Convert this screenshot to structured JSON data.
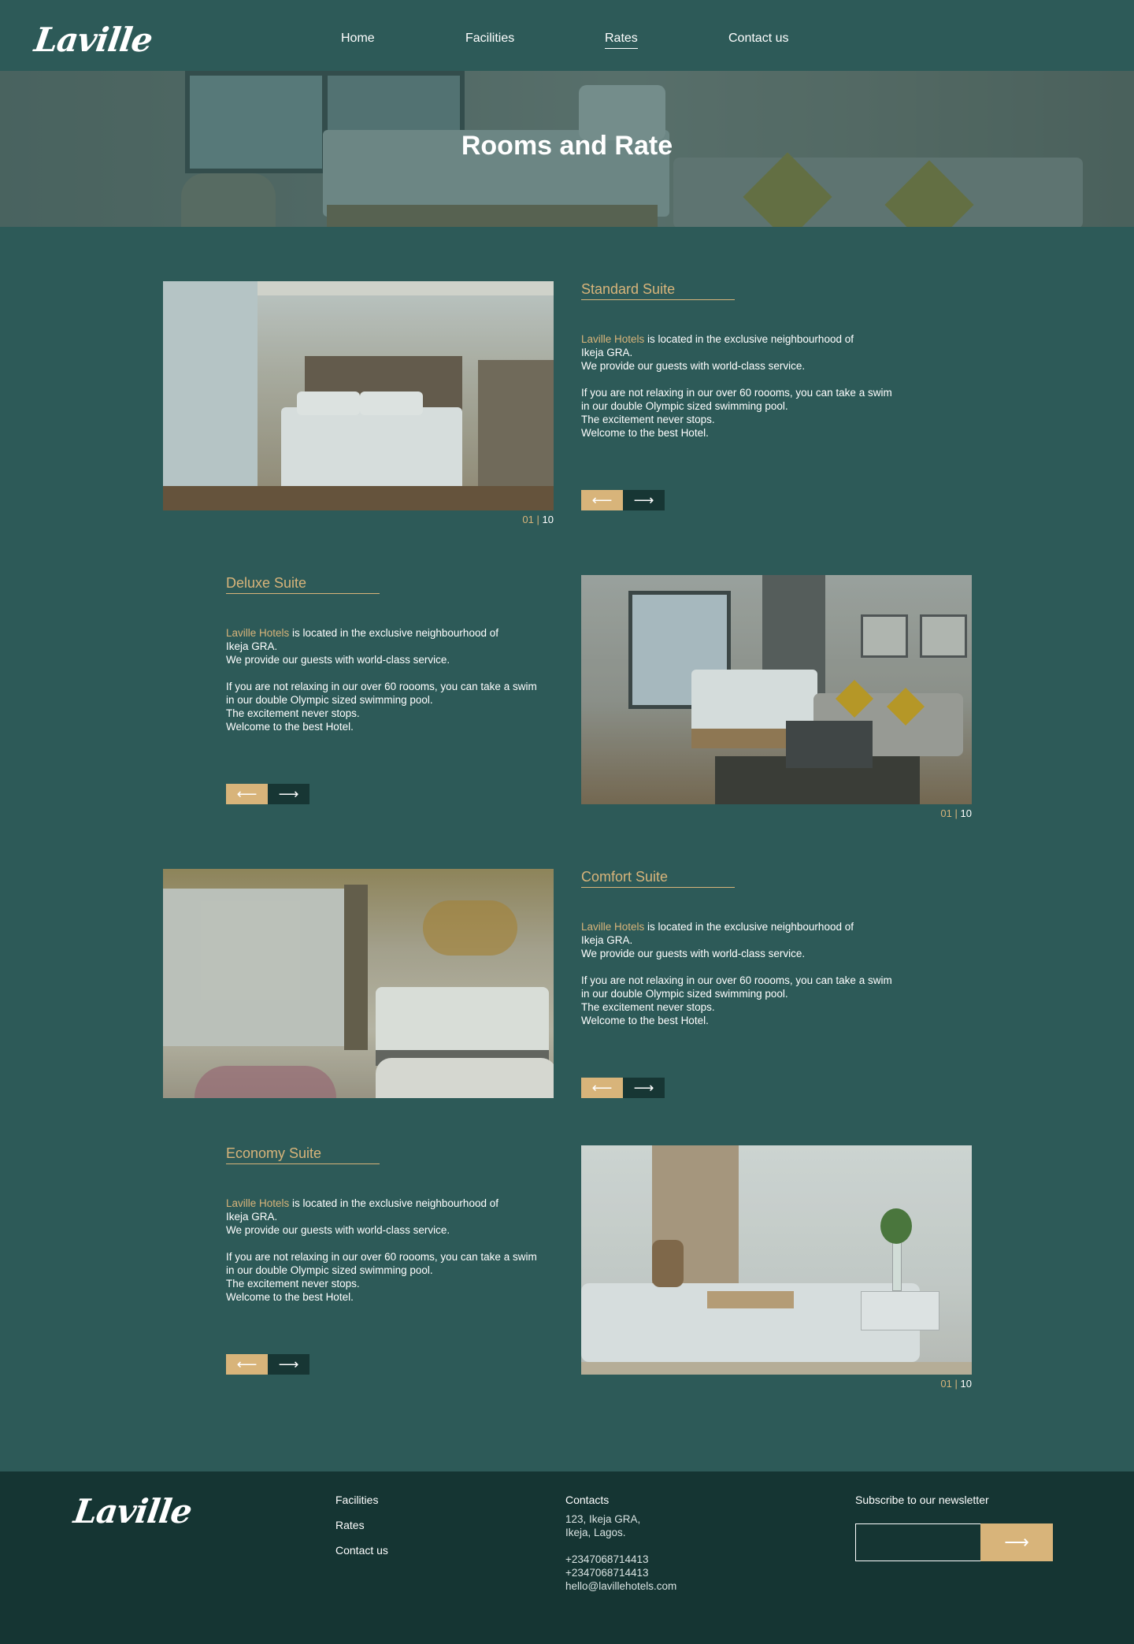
{
  "header": {
    "logo": "Laville",
    "nav": [
      {
        "label": "Home",
        "active": false
      },
      {
        "label": "Facilities",
        "active": false
      },
      {
        "label": "Rates",
        "active": true
      },
      {
        "label": "Contact us",
        "active": false
      }
    ]
  },
  "hero": {
    "title": "Rooms and Rate"
  },
  "rooms": [
    {
      "title": "Standard Suite",
      "brand": "Laville Hotels",
      "line1": " is located in the exclusive neighbourhood of",
      "line2": "Ikeja GRA.",
      "line3": "We provide our guests with world-class service.",
      "para2_1": "If you are not relaxing in our over 60 roooms, you can take a swim",
      "para2_2": "in our double Olympic sized swimming pool.",
      "para2_3": "The excitement never stops.",
      "para2_4": "Welcome to the best Hotel.",
      "counter_current": "01",
      "counter_sep": "|",
      "counter_total": "10",
      "prev_icon": "arrow-left-icon",
      "next_icon": "arrow-right-icon"
    },
    {
      "title": "Deluxe Suite",
      "brand": "Laville Hotels",
      "line1": " is located in the exclusive neighbourhood of",
      "line2": "Ikeja GRA.",
      "line3": "We provide our guests with world-class service.",
      "para2_1": "If you are not relaxing in our over 60 roooms, you can take a swim",
      "para2_2": "in our double Olympic sized swimming pool.",
      "para2_3": "The excitement never stops.",
      "para2_4": "Welcome to the best Hotel.",
      "counter_current": "01",
      "counter_sep": "|",
      "counter_total": "10",
      "prev_icon": "arrow-left-icon",
      "next_icon": "arrow-right-icon"
    },
    {
      "title": "Comfort Suite",
      "brand": "Laville Hotels",
      "line1": " is located in the exclusive neighbourhood of",
      "line2": "Ikeja GRA.",
      "line3": "We provide our guests with world-class service.",
      "para2_1": "If you are not relaxing in our over 60 roooms, you can take a swim",
      "para2_2": "in our double Olympic sized swimming pool.",
      "para2_3": "The excitement never stops.",
      "para2_4": "Welcome to the best Hotel.",
      "prev_icon": "arrow-left-icon",
      "next_icon": "arrow-right-icon"
    },
    {
      "title": "Economy Suite",
      "brand": "Laville Hotels",
      "line1": " is located in the exclusive neighbourhood of",
      "line2": "Ikeja GRA.",
      "line3": "We provide our guests with world-class service.",
      "para2_1": "If you are not relaxing in our over 60 roooms, you can take a swim",
      "para2_2": "in our double Olympic sized swimming pool.",
      "para2_3": "The excitement never stops.",
      "para2_4": "Welcome to the best Hotel.",
      "counter_current": "01",
      "counter_sep": "|",
      "counter_total": "10",
      "prev_icon": "arrow-left-icon",
      "next_icon": "arrow-right-icon"
    }
  ],
  "arrows": {
    "prev": "⟵",
    "next": "⟶"
  },
  "footer": {
    "logo": "Laville",
    "links": [
      "Facilities",
      "Rates",
      "Contact us"
    ],
    "contacts_heading": "Contacts",
    "address_1": "123, Ikeja GRA,",
    "address_2": "Ikeja, Lagos.",
    "phone_1": "+2347068714413",
    "phone_2": "+2347068714413",
    "email": "hello@lavillehotels.com",
    "newsletter_heading": "Subscribe to our newsletter",
    "subscribe_icon": "arrow-right-icon",
    "subscribe_arrow": "⟶"
  },
  "colors": {
    "background": "#2d5a58",
    "accent": "#d8b47a",
    "dark": "#153533"
  }
}
